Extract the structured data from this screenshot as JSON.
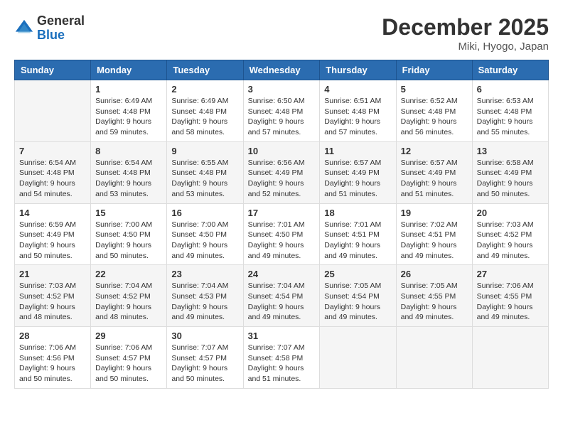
{
  "header": {
    "logo_general": "General",
    "logo_blue": "Blue",
    "month_title": "December 2025",
    "location": "Miki, Hyogo, Japan"
  },
  "calendar": {
    "days_of_week": [
      "Sunday",
      "Monday",
      "Tuesday",
      "Wednesday",
      "Thursday",
      "Friday",
      "Saturday"
    ],
    "weeks": [
      [
        {
          "day": "",
          "info": ""
        },
        {
          "day": "1",
          "info": "Sunrise: 6:49 AM\nSunset: 4:48 PM\nDaylight: 9 hours\nand 59 minutes."
        },
        {
          "day": "2",
          "info": "Sunrise: 6:49 AM\nSunset: 4:48 PM\nDaylight: 9 hours\nand 58 minutes."
        },
        {
          "day": "3",
          "info": "Sunrise: 6:50 AM\nSunset: 4:48 PM\nDaylight: 9 hours\nand 57 minutes."
        },
        {
          "day": "4",
          "info": "Sunrise: 6:51 AM\nSunset: 4:48 PM\nDaylight: 9 hours\nand 57 minutes."
        },
        {
          "day": "5",
          "info": "Sunrise: 6:52 AM\nSunset: 4:48 PM\nDaylight: 9 hours\nand 56 minutes."
        },
        {
          "day": "6",
          "info": "Sunrise: 6:53 AM\nSunset: 4:48 PM\nDaylight: 9 hours\nand 55 minutes."
        }
      ],
      [
        {
          "day": "7",
          "info": "Sunrise: 6:54 AM\nSunset: 4:48 PM\nDaylight: 9 hours\nand 54 minutes."
        },
        {
          "day": "8",
          "info": "Sunrise: 6:54 AM\nSunset: 4:48 PM\nDaylight: 9 hours\nand 53 minutes."
        },
        {
          "day": "9",
          "info": "Sunrise: 6:55 AM\nSunset: 4:48 PM\nDaylight: 9 hours\nand 53 minutes."
        },
        {
          "day": "10",
          "info": "Sunrise: 6:56 AM\nSunset: 4:49 PM\nDaylight: 9 hours\nand 52 minutes."
        },
        {
          "day": "11",
          "info": "Sunrise: 6:57 AM\nSunset: 4:49 PM\nDaylight: 9 hours\nand 51 minutes."
        },
        {
          "day": "12",
          "info": "Sunrise: 6:57 AM\nSunset: 4:49 PM\nDaylight: 9 hours\nand 51 minutes."
        },
        {
          "day": "13",
          "info": "Sunrise: 6:58 AM\nSunset: 4:49 PM\nDaylight: 9 hours\nand 50 minutes."
        }
      ],
      [
        {
          "day": "14",
          "info": "Sunrise: 6:59 AM\nSunset: 4:49 PM\nDaylight: 9 hours\nand 50 minutes."
        },
        {
          "day": "15",
          "info": "Sunrise: 7:00 AM\nSunset: 4:50 PM\nDaylight: 9 hours\nand 50 minutes."
        },
        {
          "day": "16",
          "info": "Sunrise: 7:00 AM\nSunset: 4:50 PM\nDaylight: 9 hours\nand 49 minutes."
        },
        {
          "day": "17",
          "info": "Sunrise: 7:01 AM\nSunset: 4:50 PM\nDaylight: 9 hours\nand 49 minutes."
        },
        {
          "day": "18",
          "info": "Sunrise: 7:01 AM\nSunset: 4:51 PM\nDaylight: 9 hours\nand 49 minutes."
        },
        {
          "day": "19",
          "info": "Sunrise: 7:02 AM\nSunset: 4:51 PM\nDaylight: 9 hours\nand 49 minutes."
        },
        {
          "day": "20",
          "info": "Sunrise: 7:03 AM\nSunset: 4:52 PM\nDaylight: 9 hours\nand 49 minutes."
        }
      ],
      [
        {
          "day": "21",
          "info": "Sunrise: 7:03 AM\nSunset: 4:52 PM\nDaylight: 9 hours\nand 48 minutes."
        },
        {
          "day": "22",
          "info": "Sunrise: 7:04 AM\nSunset: 4:52 PM\nDaylight: 9 hours\nand 48 minutes."
        },
        {
          "day": "23",
          "info": "Sunrise: 7:04 AM\nSunset: 4:53 PM\nDaylight: 9 hours\nand 49 minutes."
        },
        {
          "day": "24",
          "info": "Sunrise: 7:04 AM\nSunset: 4:54 PM\nDaylight: 9 hours\nand 49 minutes."
        },
        {
          "day": "25",
          "info": "Sunrise: 7:05 AM\nSunset: 4:54 PM\nDaylight: 9 hours\nand 49 minutes."
        },
        {
          "day": "26",
          "info": "Sunrise: 7:05 AM\nSunset: 4:55 PM\nDaylight: 9 hours\nand 49 minutes."
        },
        {
          "day": "27",
          "info": "Sunrise: 7:06 AM\nSunset: 4:55 PM\nDaylight: 9 hours\nand 49 minutes."
        }
      ],
      [
        {
          "day": "28",
          "info": "Sunrise: 7:06 AM\nSunset: 4:56 PM\nDaylight: 9 hours\nand 50 minutes."
        },
        {
          "day": "29",
          "info": "Sunrise: 7:06 AM\nSunset: 4:57 PM\nDaylight: 9 hours\nand 50 minutes."
        },
        {
          "day": "30",
          "info": "Sunrise: 7:07 AM\nSunset: 4:57 PM\nDaylight: 9 hours\nand 50 minutes."
        },
        {
          "day": "31",
          "info": "Sunrise: 7:07 AM\nSunset: 4:58 PM\nDaylight: 9 hours\nand 51 minutes."
        },
        {
          "day": "",
          "info": ""
        },
        {
          "day": "",
          "info": ""
        },
        {
          "day": "",
          "info": ""
        }
      ]
    ]
  }
}
